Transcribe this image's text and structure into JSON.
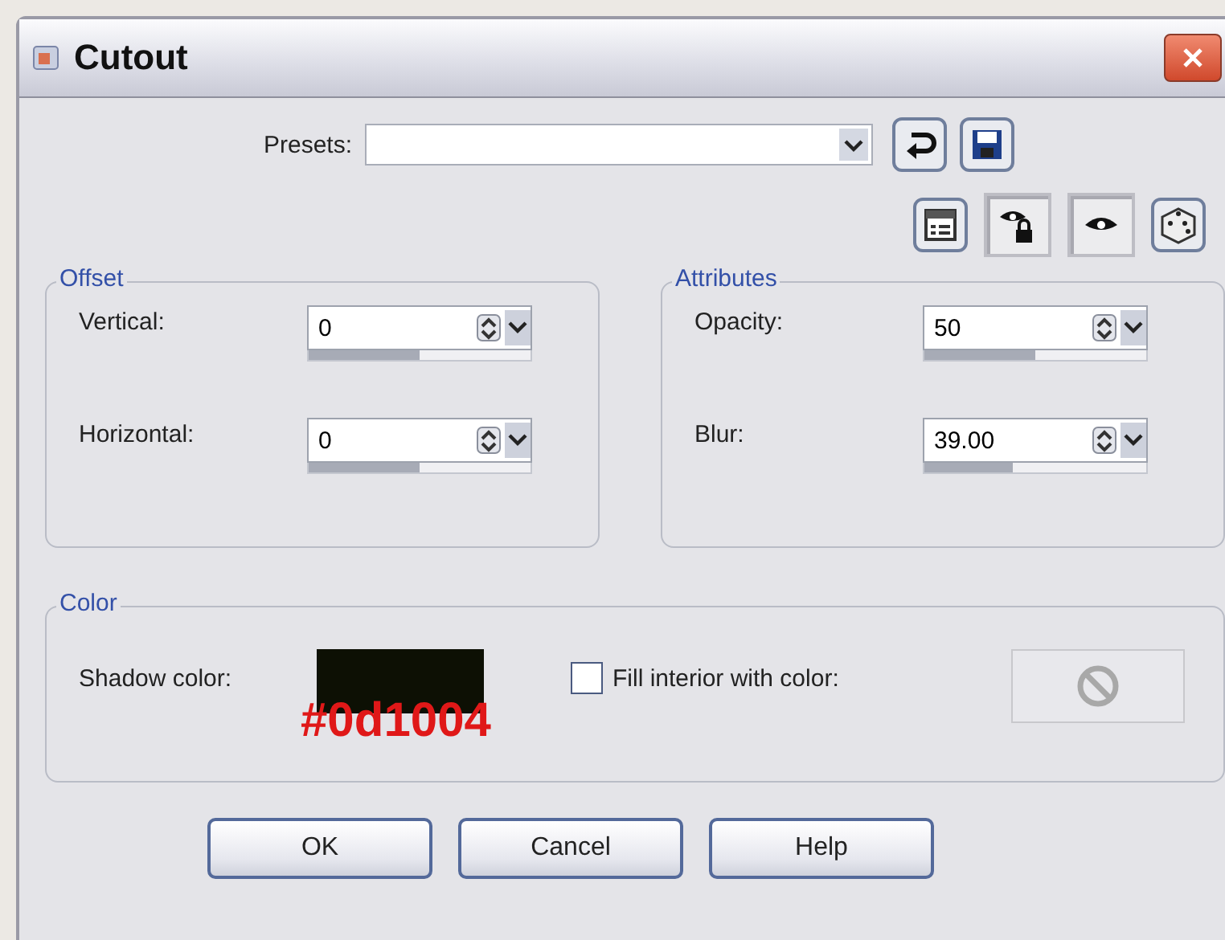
{
  "window": {
    "title": "Cutout"
  },
  "presets": {
    "label": "Presets:"
  },
  "tool_buttons": [
    {
      "kind": "reset",
      "pressed": false
    },
    {
      "kind": "save",
      "pressed": false
    },
    {
      "kind": "dialog",
      "pressed": false
    },
    {
      "kind": "eye-lock",
      "pressed": true
    },
    {
      "kind": "eye",
      "pressed": true
    },
    {
      "kind": "dice",
      "pressed": false
    }
  ],
  "groups": [
    {
      "title": "Offset",
      "fields": [
        {
          "label": "Vertical:",
          "value": "0",
          "level": 0.5
        },
        {
          "label": "Horizontal:",
          "value": "0",
          "level": 0.5
        }
      ]
    },
    {
      "title": "Attributes",
      "fields": [
        {
          "label": "Opacity:",
          "value": "50",
          "level": 0.5
        },
        {
          "label": "Blur:",
          "value": "39.00",
          "level": 0.4
        }
      ]
    }
  ],
  "color": {
    "title": "Color",
    "shadow_label": "Shadow color:",
    "shadow_color": "#0d1004",
    "fill_label": "Fill interior with color:",
    "fill_checked": false,
    "fill_disabled": true
  },
  "buttons": [
    "OK",
    "Cancel",
    "Help"
  ]
}
